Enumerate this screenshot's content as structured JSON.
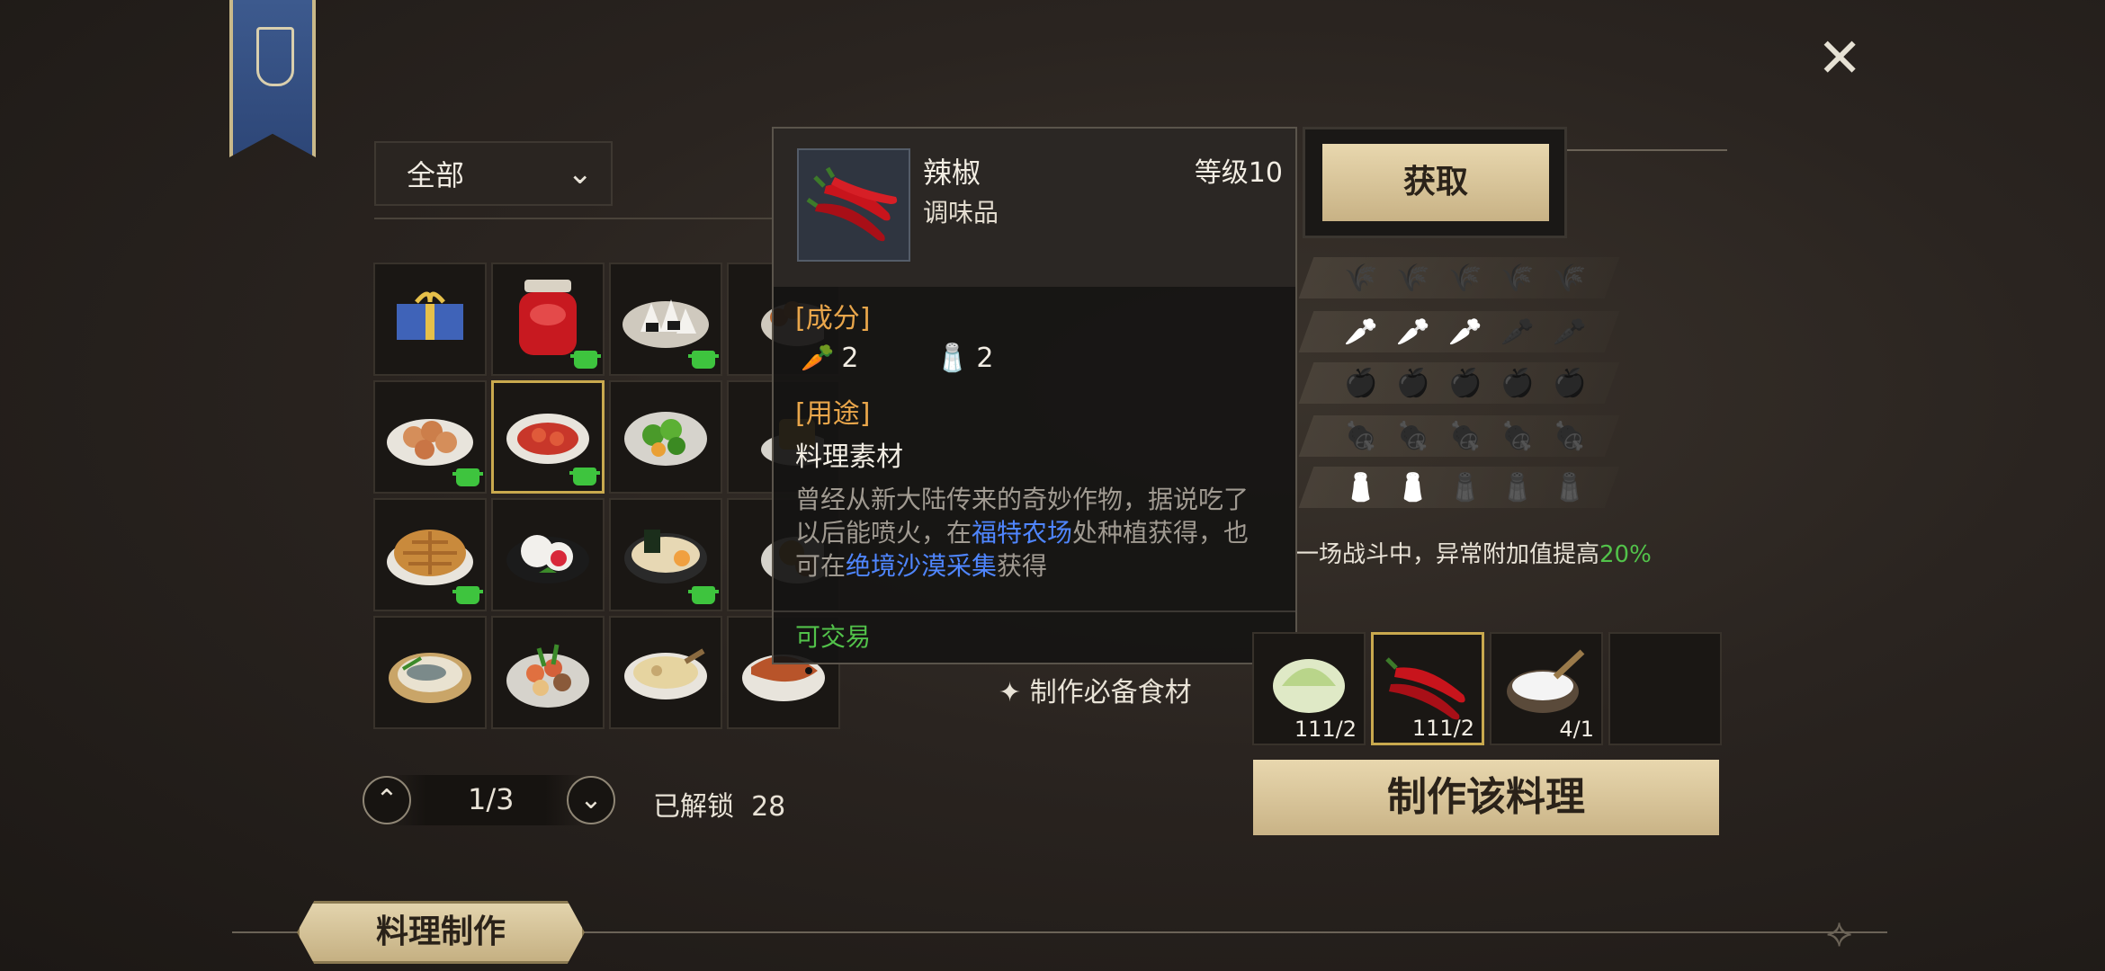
{
  "header": {
    "close_icon": "close-icon"
  },
  "filter": {
    "selected": "全部"
  },
  "grid": {
    "items": [
      {
        "name": "gift-box",
        "pot": false,
        "selected": false
      },
      {
        "name": "chili-sauce-jar",
        "pot": true,
        "selected": false
      },
      {
        "name": "rice-balls",
        "pot": true,
        "selected": false
      },
      {
        "name": "skewers",
        "pot": false,
        "selected": false
      },
      {
        "name": "fried-dumplings",
        "pot": true,
        "selected": false
      },
      {
        "name": "spicy-shrimp",
        "pot": true,
        "selected": true
      },
      {
        "name": "vegetable-salad",
        "pot": false,
        "selected": false
      },
      {
        "name": "pudding",
        "pot": false,
        "selected": false
      },
      {
        "name": "pie",
        "pot": true,
        "selected": false
      },
      {
        "name": "strawberry-mochi",
        "pot": false,
        "selected": false
      },
      {
        "name": "ramen",
        "pot": true,
        "selected": false
      },
      {
        "name": "fried-food",
        "pot": false,
        "selected": false
      },
      {
        "name": "steamed-fish-basket",
        "pot": false,
        "selected": false
      },
      {
        "name": "seafood-platter",
        "pot": false,
        "selected": false
      },
      {
        "name": "soup-bowl",
        "pot": false,
        "selected": false
      },
      {
        "name": "grilled-fish",
        "pot": false,
        "selected": false
      }
    ]
  },
  "pager": {
    "page": "1/3",
    "unlocked_label": "已解锁",
    "unlocked_count": "28"
  },
  "tooltip": {
    "name": "辣椒",
    "type": "调味品",
    "level": "等级10",
    "ingredients_title": "[成分]",
    "ingredients": [
      {
        "icon": "carrot-icon",
        "count": "2"
      },
      {
        "icon": "spice-icon",
        "count": "2"
      }
    ],
    "usage_title": "[用途]",
    "usage": "料理素材",
    "desc_1": "曾经从新大陆传来的奇妙作物，据说吃了以后能喷火，在",
    "link_1": "福特农场",
    "desc_2": "处种植获得，也可在",
    "link_2": "绝境沙漠采集",
    "desc_3": "获得",
    "tradeable": "可交易"
  },
  "acquire": {
    "label": "获取"
  },
  "attributes": {
    "rows": [
      {
        "icon": "wheat-icon",
        "filled": 0
      },
      {
        "icon": "carrot-icon",
        "filled": 3
      },
      {
        "icon": "apple-icon",
        "filled": 0
      },
      {
        "icon": "meat-icon",
        "filled": 0
      },
      {
        "icon": "spice-icon",
        "filled": 2
      }
    ],
    "bonus_text": "一场战斗中，异常附加值提高",
    "bonus_value": "20%"
  },
  "recipe": {
    "required_label": "制作必备食材",
    "slots": [
      {
        "name": "cabbage",
        "count": "111/2",
        "selected": false
      },
      {
        "name": "chili",
        "count": "111/2",
        "selected": true
      },
      {
        "name": "salt",
        "count": "4/1",
        "selected": false
      },
      {
        "name": "empty",
        "count": "",
        "selected": false
      }
    ],
    "craft_label": "制作该料理"
  },
  "bottom_tab": {
    "label": "料理制作"
  },
  "colors": {
    "gold": "#c9a94e",
    "green": "#52c24a",
    "link": "#4f86ff",
    "orange": "#e9a64b"
  }
}
